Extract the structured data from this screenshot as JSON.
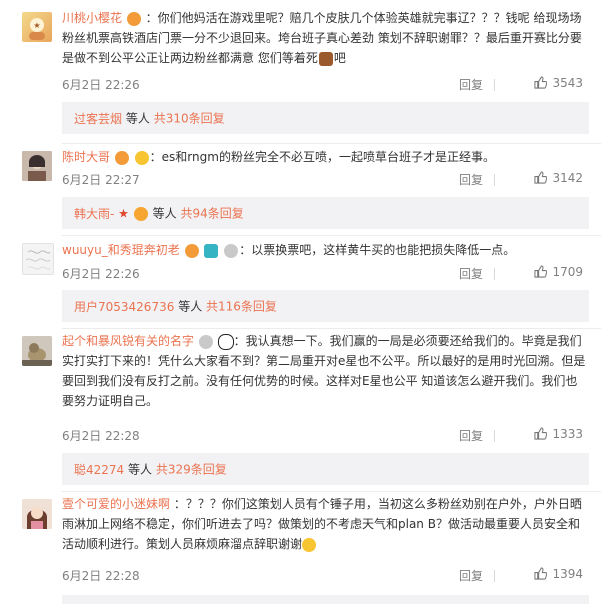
{
  "comments": [
    {
      "author": "川桃小樱花",
      "text": "：你们他妈活在游戏里呢？赔几个皮肤几个体验英雄就完事辽？？？钱呢 给现场场粉丝机票高铁酒店门票一分不少退回来。垮台班子真心差劲 策划不辞职谢罪？？最后重开赛比分要是做不到公平公正让两边粉丝都满意 您们等着死",
      "text_tail": "吧",
      "time": "6月2日 22:26",
      "reply_label": "回复",
      "likes": "3543",
      "replies": {
        "author": "过客芸烟",
        "mid": "等人",
        "count": "共310条回复"
      }
    },
    {
      "author": "陈时大哥",
      "text": "：es和rngm的粉丝完全不必互喷，一起喷草台班子才是正经事。",
      "time": "6月2日 22:27",
      "reply_label": "回复",
      "likes": "3142",
      "replies": {
        "author": "韩大雨-",
        "mid": "等人",
        "count": "共94条回复"
      }
    },
    {
      "author": "wuuyu_和秀琨奔初老",
      "text": "：以票换票吧，这样黄牛买的也能把损失降低一点。",
      "time": "6月2日 22:26",
      "reply_label": "回复",
      "likes": "1709",
      "replies": {
        "author": "用户7053426736",
        "mid": "等人",
        "count": "共116条回复"
      }
    },
    {
      "author": "起个和暴风锐有关的名字",
      "text": "：我认真想一下。我们赢的一局是必须要还给我们的。毕竟是我们实打实打下来的！凭什么大家看不到？第二局重开对e星也不公平。所以最好的是用时光回溯。但是要回到我们没有反打之前。没有任何优势的时候。这样对E星也公平 知道该怎么避开我们。我们也要努力证明自己。",
      "time": "6月2日 22:28",
      "reply_label": "回复",
      "likes": "1333",
      "replies": {
        "author": "聪42274",
        "mid": "等人",
        "count": "共329条回复"
      }
    },
    {
      "author": "壹个可爱的小迷妹啊",
      "text": "：？？？你们这策划人员有个锤子用，当初这么多粉丝劝别在户外，户外日晒雨淋加上网络不稳定，你们听进去了吗？做策划的不考虑天气和plan B？做活动最重要人员安全和活动顺利进行。策划人员麻烦麻溜点辞职谢谢",
      "time": "6月2日 22:28",
      "reply_label": "回复",
      "likes": "1394"
    }
  ],
  "colors": {
    "name": "#eb7350",
    "text": "#333333",
    "meta": "#808080",
    "reply_bg": "#f2f2f5"
  }
}
